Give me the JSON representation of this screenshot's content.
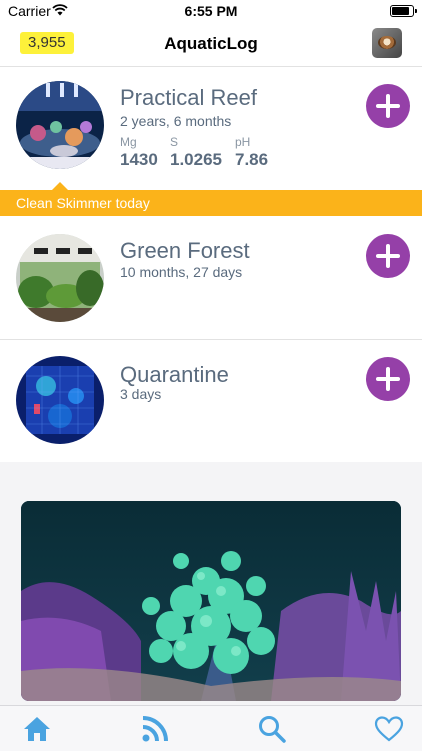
{
  "status": {
    "carrier": "Carrier",
    "time": "6:55 PM"
  },
  "header": {
    "points": "3,955",
    "title": "AquaticLog"
  },
  "tanks": [
    {
      "name": "Practical Reef",
      "age": "2 years, 6 months",
      "params": [
        {
          "label": "Mg",
          "value": "1430"
        },
        {
          "label": "S",
          "value": "1.0265"
        },
        {
          "label": "pH",
          "value": "7.86"
        }
      ],
      "reminder": "Clean Skimmer today"
    },
    {
      "name": "Green Forest",
      "age": "10 months, 27 days"
    },
    {
      "name": "Quarantine",
      "age": "3 days"
    }
  ],
  "colors": {
    "accent": "#9540a8",
    "banner": "#fbb31a",
    "points_bg": "#fdf13a",
    "tab_blue": "#4aa3e0"
  },
  "tabbar": {
    "icons": [
      "home-icon",
      "feed-icon",
      "search-icon",
      "heart-icon"
    ]
  }
}
